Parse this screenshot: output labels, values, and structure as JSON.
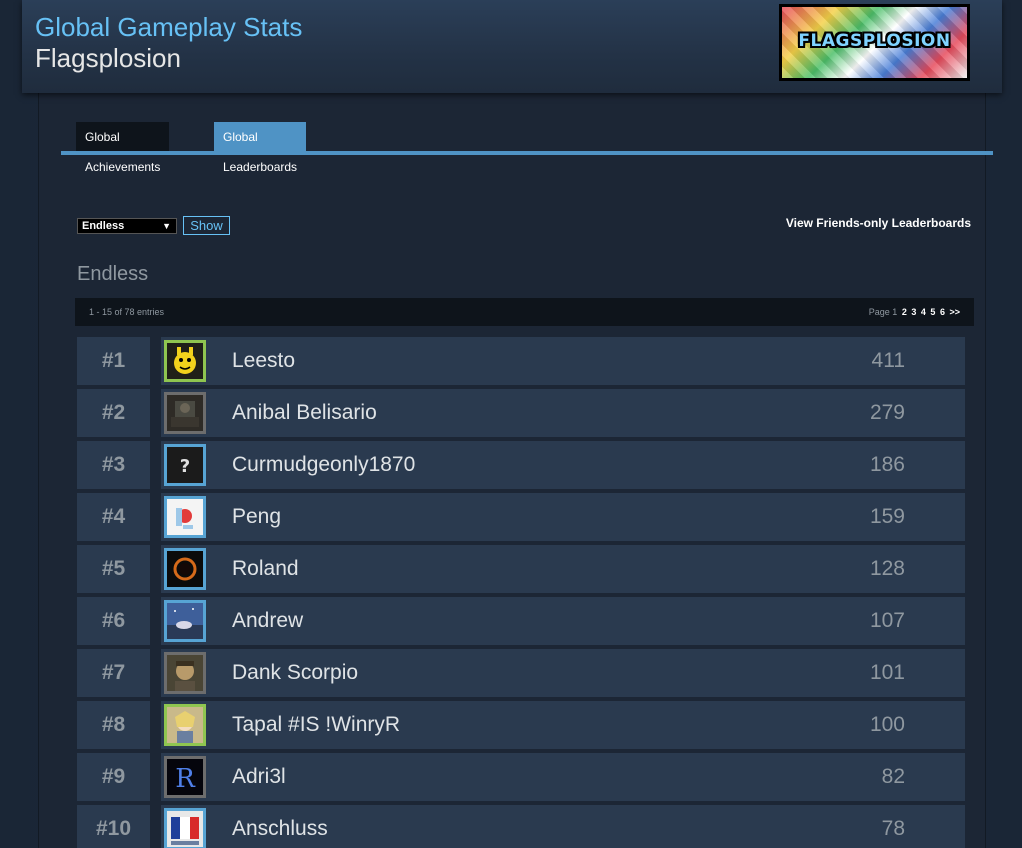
{
  "header": {
    "title": "Global Gameplay Stats",
    "game_name": "Flagsplosion",
    "logo_text": "FLAGSPLOSION"
  },
  "tabs": [
    {
      "label": "Global Achievements",
      "active": false
    },
    {
      "label": "Global Leaderboards",
      "active": true
    }
  ],
  "controls": {
    "selected_leaderboard": "Endless",
    "show_label": "Show",
    "friends_link": "View Friends-only Leaderboards"
  },
  "leaderboard": {
    "title": "Endless",
    "entries_text": "1 - 15 of 78 entries",
    "page_label": "Page 1",
    "pages": [
      "2",
      "3",
      "4",
      "5",
      "6",
      ">>"
    ],
    "rows": [
      {
        "rank": "#1",
        "name": "Leesto",
        "score": "411",
        "status": "online",
        "avatar": "yellow-character"
      },
      {
        "rank": "#2",
        "name": "Anibal Belisario",
        "score": "279",
        "status": "offline",
        "avatar": "dark-scene"
      },
      {
        "rank": "#3",
        "name": "Curmudgeonly1870",
        "score": "186",
        "status": "blue",
        "avatar": "question-mark"
      },
      {
        "rank": "#4",
        "name": "Peng",
        "score": "159",
        "status": "blue",
        "avatar": "white-red"
      },
      {
        "rank": "#5",
        "name": "Roland",
        "score": "128",
        "status": "blue",
        "avatar": "dark-ring"
      },
      {
        "rank": "#6",
        "name": "Andrew",
        "score": "107",
        "status": "blue",
        "avatar": "sky-scene"
      },
      {
        "rank": "#7",
        "name": "Dank Scorpio",
        "score": "101",
        "status": "offline",
        "avatar": "portrait"
      },
      {
        "rank": "#8",
        "name": "Tapal #IS !WinryR",
        "score": "100",
        "status": "online",
        "avatar": "anime-girl"
      },
      {
        "rank": "#9",
        "name": "Adri3l",
        "score": "82",
        "status": "offline",
        "avatar": "letter-r"
      },
      {
        "rank": "#10",
        "name": "Anschluss",
        "score": "78",
        "status": "blue",
        "avatar": "flag"
      }
    ]
  }
}
